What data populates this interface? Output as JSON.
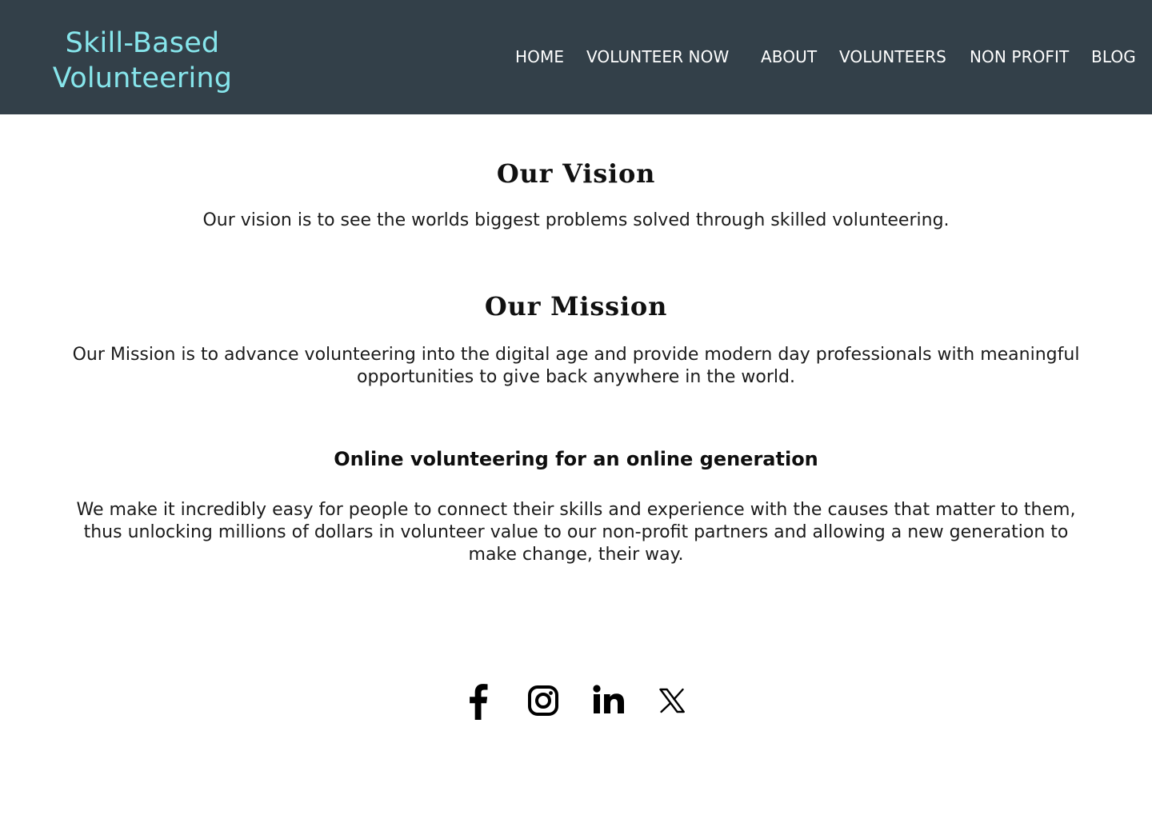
{
  "header": {
    "brand_line1": "Skill-Based",
    "brand_line2": "Volunteering",
    "nav": {
      "home": "HOME",
      "volunteer_now": "VOLUNTEER NOW",
      "about": "ABOUT",
      "volunteers": "VOLUNTEERS",
      "non_profit": "NON PROFIT",
      "blog": "BLOG"
    }
  },
  "vision": {
    "heading": "Our Vision",
    "text": "Our vision is to see the worlds biggest problems solved through skilled volunteering."
  },
  "mission": {
    "heading": "Our Mission",
    "text": "Our Mission is to advance volunteering into the digital age and provide modern day professionals with meaningful opportunities to give back anywhere in the world."
  },
  "online": {
    "heading": "Online volunteering for an online generation",
    "text": "We make it incredibly easy for people to connect their skills and experience with the causes that matter to them, thus unlocking millions of dollars in volunteer value to our non-profit partners and allowing a new generation to make change, their way."
  },
  "social": {
    "icons": [
      "facebook-icon",
      "instagram-icon",
      "linkedin-icon",
      "x-icon"
    ]
  },
  "colors": {
    "header_bg": "#334049",
    "brand": "#87e6ec",
    "nav_text": "#ffffff",
    "page_bg": "#ffffff",
    "text": "#1b1b1b"
  }
}
